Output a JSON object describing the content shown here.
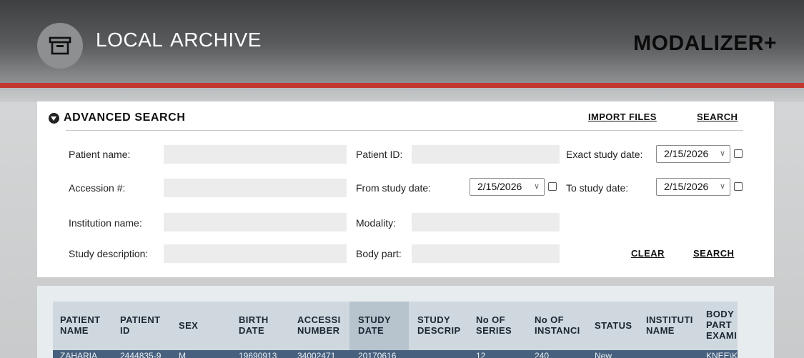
{
  "header": {
    "title": "LOCAL  ARCHIVE",
    "brand": "MODALIZER+",
    "icon": "archive-box-icon"
  },
  "search": {
    "title": "ADVANCED  SEARCH",
    "import_label": "IMPORT FILES",
    "search_top_label": "SEARCH",
    "fields": {
      "patient_name": {
        "label": "Patient name:",
        "value": ""
      },
      "patient_id": {
        "label": "Patient ID:",
        "value": ""
      },
      "exact_date": {
        "label": "Exact study date:",
        "value": "2/15/2026",
        "checked": false
      },
      "accession": {
        "label": "Accession #:",
        "value": ""
      },
      "from_date": {
        "label": "From study date:",
        "value": "2/15/2026",
        "checked": false
      },
      "to_date": {
        "label": "To study date:",
        "value": "2/15/2026",
        "checked": false
      },
      "institution": {
        "label": "Institution name:",
        "value": ""
      },
      "modality": {
        "label": "Modality:",
        "value": ""
      },
      "study_desc": {
        "label": "Study description:",
        "value": ""
      },
      "body_part": {
        "label": "Body part:",
        "value": ""
      }
    },
    "clear_label": "CLEAR",
    "search_label": "SEARCH"
  },
  "table": {
    "sorted_column": "STUDY DATE",
    "columns": [
      {
        "line1": "PATIENT",
        "line2": "NAME"
      },
      {
        "line1": "PATIENT",
        "line2": "ID"
      },
      {
        "line1": "SEX",
        "line2": ""
      },
      {
        "line1": "BIRTH",
        "line2": "DATE"
      },
      {
        "line1": "ACCESSI",
        "line2": "NUMBER"
      },
      {
        "line1": "STUDY",
        "line2": "DATE"
      },
      {
        "line1": "STUDY",
        "line2": "DESCRIP"
      },
      {
        "line1": "No OF",
        "line2": "SERIES"
      },
      {
        "line1": "No OF",
        "line2": "INSTANCI"
      },
      {
        "line1": "STATUS",
        "line2": ""
      },
      {
        "line1": "INSTITUTI",
        "line2": "NAME"
      },
      {
        "line1": "BODY",
        "line2": "PART",
        "line3": "EXAMINE"
      }
    ],
    "rows": [
      [
        "ZAHARIA",
        "2444835-9",
        "M",
        "19690913",
        "34002471",
        "20170616",
        "",
        "12",
        "240",
        "New",
        "",
        "KNEE\\K"
      ]
    ]
  },
  "colors": {
    "accent_red": "#c2382e",
    "header_dark": "#3e3f40",
    "row_selected": "#46607d"
  }
}
